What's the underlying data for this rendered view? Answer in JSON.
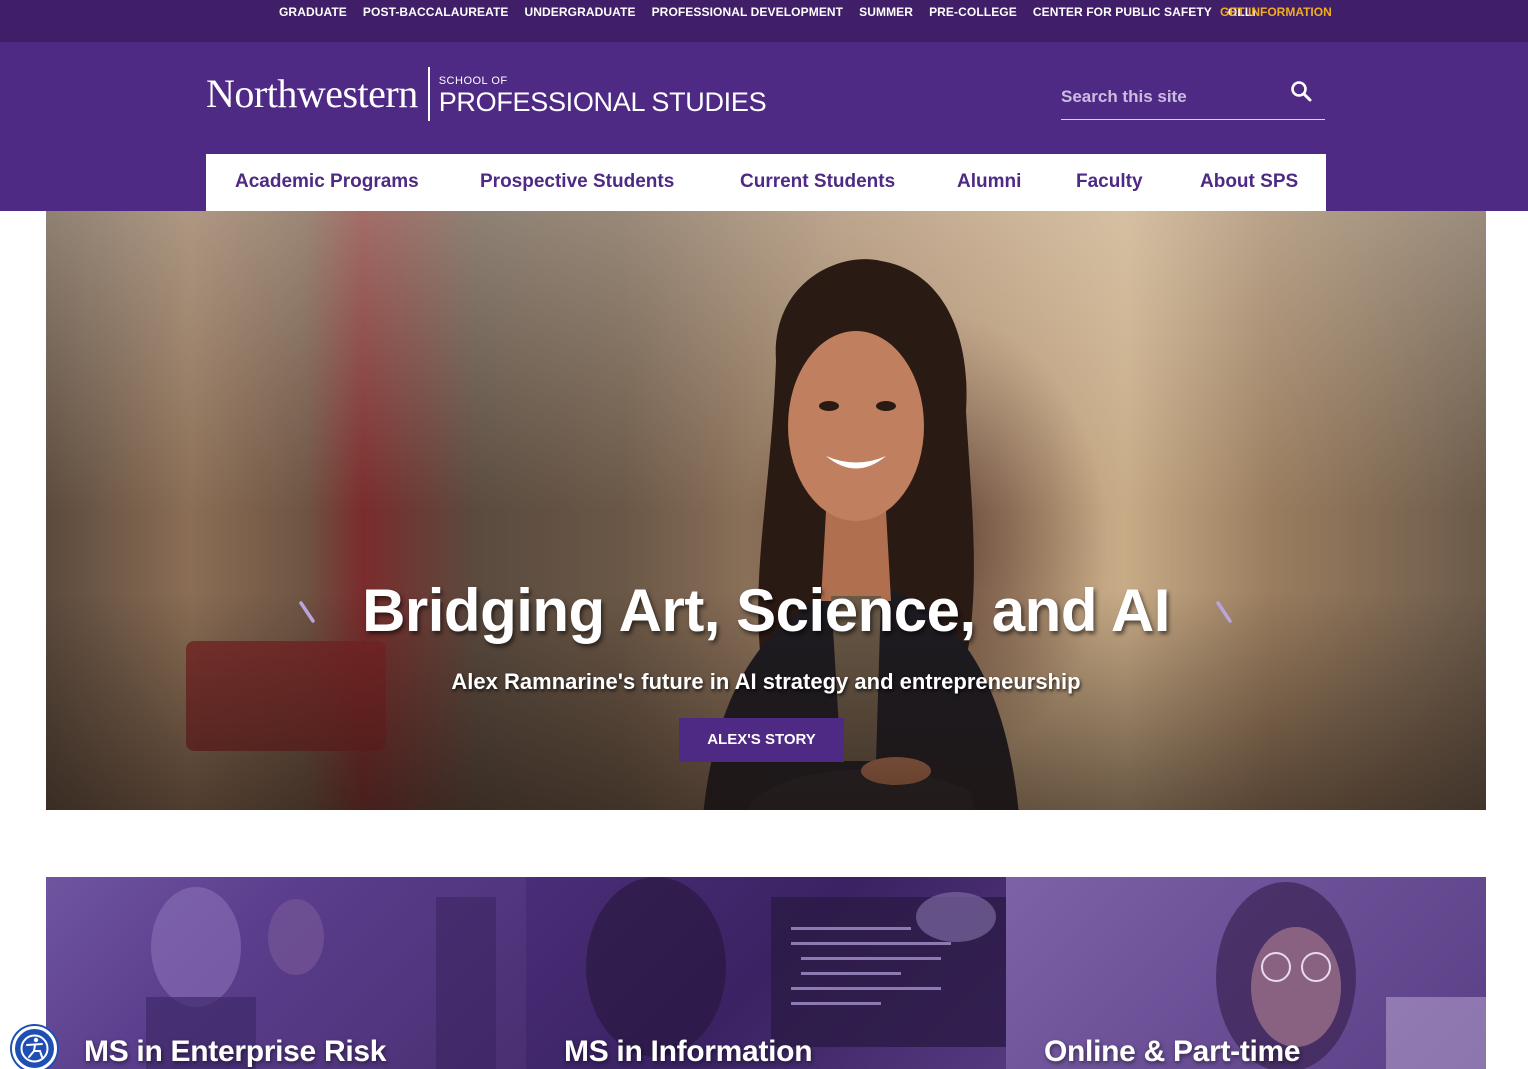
{
  "utility_nav": {
    "items": [
      "GRADUATE",
      "POST-BACCALAUREATE",
      "UNDERGRADUATE",
      "PROFESSIONAL DEVELOPMENT",
      "SUMMER",
      "PRE-COLLEGE",
      "CENTER FOR PUBLIC SAFETY",
      "OLLI"
    ],
    "get_info": "GET INFORMATION"
  },
  "logo": {
    "wordmark": "Northwestern",
    "school_of": "SCHOOL OF",
    "name": "PROFESSIONAL STUDIES"
  },
  "search": {
    "placeholder": "Search this site",
    "value": "",
    "icon": "search-icon"
  },
  "main_nav": {
    "items": [
      "Academic Programs",
      "Prospective Students",
      "Current Students",
      "Alumni",
      "Faculty",
      "About SPS"
    ]
  },
  "hero": {
    "title": "Bridging Art, Science, and AI",
    "subtitle": "Alex Ramnarine's future in AI strategy and entrepreneurship",
    "cta": "ALEX'S STORY"
  },
  "cards": [
    {
      "title": "MS in Enterprise Risk"
    },
    {
      "title": "MS in Information"
    },
    {
      "title": "Online & Part-time"
    }
  ],
  "accessibility": {
    "icon": "accessibility-icon"
  },
  "colors": {
    "brand_purple": "#4e2a84",
    "utility_purple": "#401f68",
    "gold": "#f2ad1e",
    "white": "#ffffff"
  }
}
